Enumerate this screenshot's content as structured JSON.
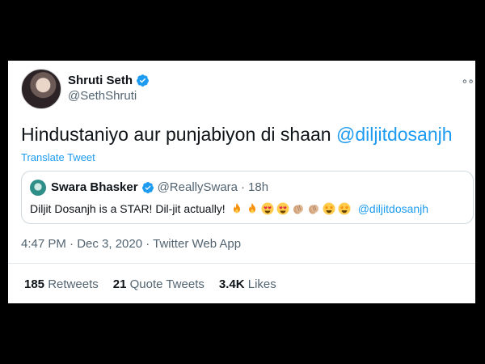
{
  "tweet": {
    "author": {
      "name": "Shruti Seth",
      "handle": "@SethShruti",
      "verified": true
    },
    "text_main": "Hindustaniyo aur punjabiyon di shaan",
    "text_mention": "@diljitdosanjh",
    "translate_label": "Translate Tweet",
    "more_icon": "more-options-icon",
    "quote": {
      "name": "Swara Bhasker",
      "handle": "@ReallySwara",
      "separator": "·",
      "age": "18h",
      "text": "Diljit Dosanjh is a STAR! Dil-jit actually!",
      "emojis": [
        "fire",
        "fire",
        "heart-eyes",
        "heart-eyes",
        "clapping-hands",
        "clapping-hands",
        "star-struck",
        "star-struck"
      ],
      "mention": "@diljitdosanjh"
    },
    "timestamp": "4:47 PM · Dec 3, 2020 · Twitter Web App",
    "stats": [
      {
        "count": "185",
        "label": "Retweets"
      },
      {
        "count": "21",
        "label": "Quote Tweets"
      },
      {
        "count": "3.4K",
        "label": "Likes"
      }
    ]
  },
  "colors": {
    "link": "#1d9bf0",
    "secondary_text": "#536471",
    "primary_text": "#0f1419",
    "background_outer": "#000000",
    "card": "#ffffff"
  }
}
